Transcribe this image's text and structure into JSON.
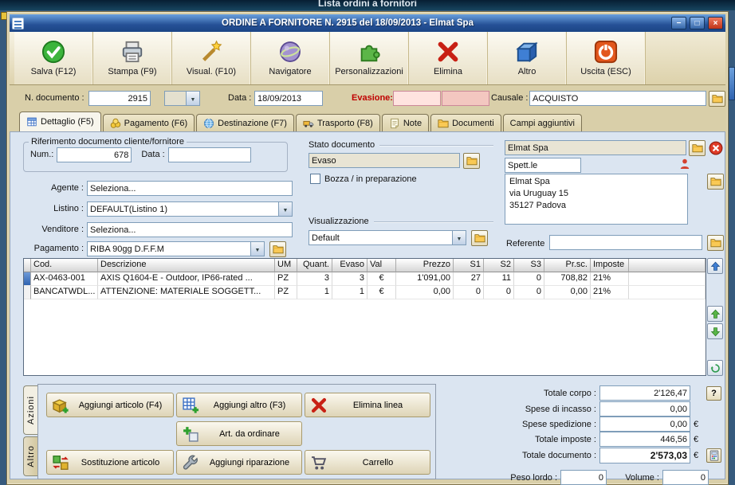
{
  "backdrop": {
    "title": "Lista ordini a fornitori"
  },
  "window": {
    "title": "ORDINE A FORNITORE N. 2915 del 18/09/2013 - Elmat Spa",
    "minimize": "−",
    "maximize": "□",
    "close": "×"
  },
  "toolbar": [
    {
      "label": "Salva (F12)"
    },
    {
      "label": "Stampa (F9)"
    },
    {
      "label": "Visual. (F10)"
    },
    {
      "label": "Navigatore"
    },
    {
      "label": "Personalizzazioni"
    },
    {
      "label": "Elimina"
    },
    {
      "label": "Altro"
    },
    {
      "label": "Uscita (ESC)"
    }
  ],
  "header": {
    "n_doc_label": "N. documento :",
    "n_doc_value": "2915",
    "data_label": "Data :",
    "data_value": "18/09/2013",
    "evasione_label": "Evasione:",
    "evasione_value1": "",
    "evasione_value2": "",
    "causale_label": "Causale :",
    "causale_value": "ACQUISTO"
  },
  "tabs": [
    {
      "label": "Dettaglio (F5)"
    },
    {
      "label": "Pagamento (F6)"
    },
    {
      "label": "Destinazione (F7)"
    },
    {
      "label": "Trasporto (F8)"
    },
    {
      "label": "Note"
    },
    {
      "label": "Documenti"
    },
    {
      "label": "Campi aggiuntivi"
    }
  ],
  "detail": {
    "rif_title": "Riferimento documento cliente/fornitore",
    "rif_num_label": "Num.:",
    "rif_num_value": "678",
    "rif_data_label": "Data :",
    "rif_data_value": "",
    "agente_label": "Agente :",
    "agente_value": "Seleziona...",
    "listino_label": "Listino :",
    "listino_value": "DEFAULT(Listino 1)",
    "venditore_label": "Venditore :",
    "venditore_value": "Seleziona...",
    "pagamento_label": "Pagamento :",
    "pagamento_value": "RIBA 90gg D.F.F.M",
    "stato_title": "Stato documento",
    "stato_value": "Evaso",
    "bozza_label": "Bozza / in preparazione",
    "vis_title": "Visualizzazione",
    "vis_value": "Default",
    "fornitore_name": "Elmat Spa",
    "salutation": "Spett.le",
    "address_line1": "Elmat Spa",
    "address_line2": "via Uruguay 15",
    "address_line3": "35127 Padova",
    "referente_label": "Referente",
    "referente_value": ""
  },
  "grid": {
    "columns": [
      "Cod.",
      "Descrizione",
      "UM",
      "Quant.",
      "Evaso",
      "Val",
      "Prezzo",
      "S1",
      "S2",
      "S3",
      "Pr.sc.",
      "Imposte"
    ],
    "rows": [
      [
        "AX-0463-001",
        "AXIS Q1604-E - Outdoor, IP66-rated ...",
        "PZ",
        "3",
        "3",
        "€",
        "1'091,00",
        "27",
        "11",
        "0",
        "708,82",
        "21%"
      ],
      [
        "BANCATWDL...",
        "ATTENZIONE: MATERIALE SOGGETT...",
        "PZ",
        "1",
        "1",
        "€",
        "0,00",
        "0",
        "0",
        "0",
        "0,00",
        "21%"
      ]
    ]
  },
  "actions": {
    "tab_azioni": "Azioni",
    "tab_altro": "Altro",
    "btn_add_article": "Aggiungi articolo (F4)",
    "btn_add_other": "Aggiungi altro (F3)",
    "btn_delete_line": "Elimina linea",
    "btn_to_order": "Art. da ordinare",
    "btn_substitute": "Sostituzione articolo",
    "btn_repair": "Aggiungi riparazione",
    "btn_cart": "Carrello"
  },
  "totals": {
    "corpo_label": "Totale corpo :",
    "corpo_value": "2'126,47",
    "help": "?",
    "incasso_label": "Spese di incasso :",
    "incasso_value": "0,00",
    "sped_label": "Spese spedizione :",
    "sped_value": "0,00",
    "imposte_label": "Totale imposte :",
    "imposte_value": "446,56",
    "doc_label": "Totale documento :",
    "doc_value": "2'573,03",
    "euro": "€",
    "peso_label": "Peso lordo :",
    "peso_value": "0",
    "volume_label": "Volume :",
    "volume_value": "0"
  }
}
